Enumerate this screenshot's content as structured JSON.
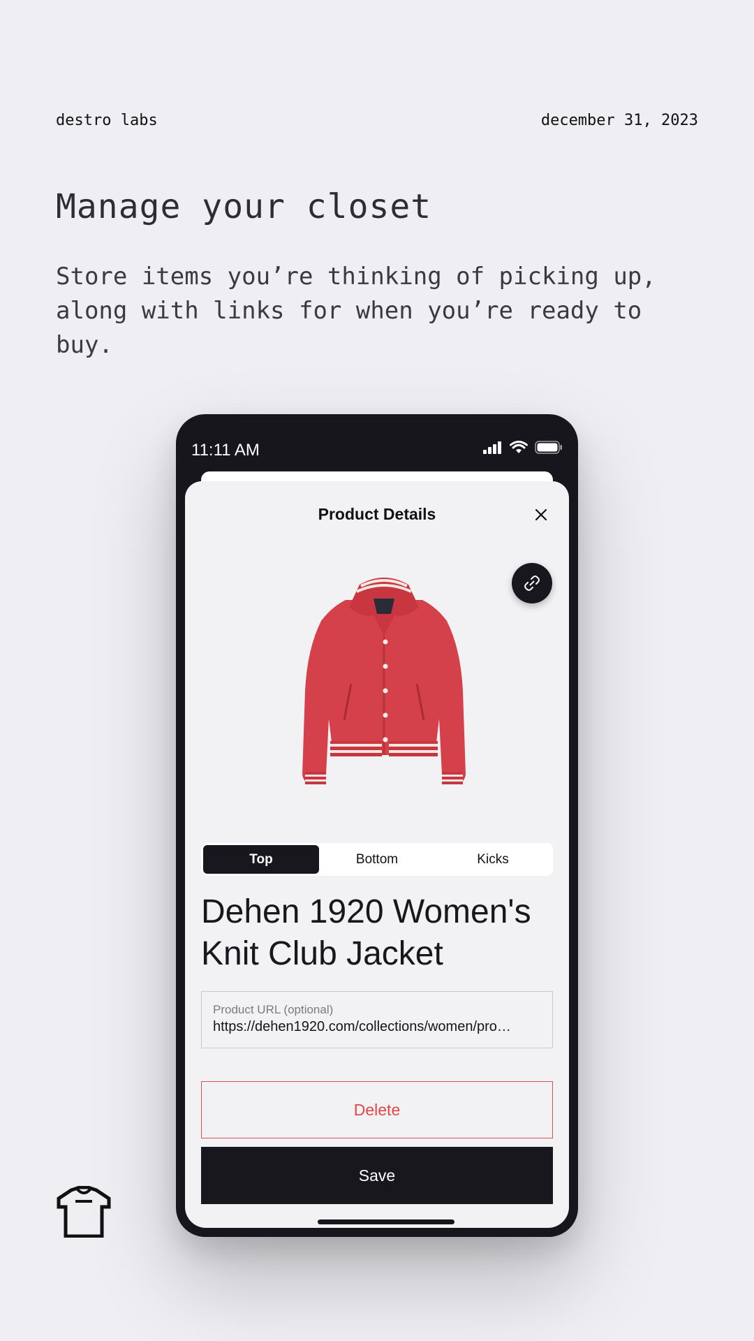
{
  "page": {
    "brand": "destro labs",
    "date": "december 31, 2023",
    "headline": "Manage your closet",
    "subtext": "Store items you’re thinking of picking up, along with links for when you’re ready to buy."
  },
  "phone": {
    "status_time": "11:11 AM",
    "sheet": {
      "title": "Product Details",
      "segments": [
        "Top",
        "Bottom",
        "Kicks"
      ],
      "selected_segment": "Top",
      "product_name": "Dehen 1920 Women's Knit Club Jacket",
      "url_field": {
        "label": "Product URL (optional)",
        "value": "https://dehen1920.com/collections/women/pro…"
      },
      "delete_label": "Delete",
      "save_label": "Save"
    }
  },
  "colors": {
    "background": "#eeeef3",
    "phone_frame": "#16161c",
    "sheet": "#f2f2f5",
    "accent_dark": "#17171d",
    "danger": "#e04848",
    "jacket_red": "#d4414a"
  },
  "icons": [
    "signal-icon",
    "wifi-icon",
    "battery-icon",
    "close-icon",
    "link-icon",
    "tshirt-icon"
  ]
}
